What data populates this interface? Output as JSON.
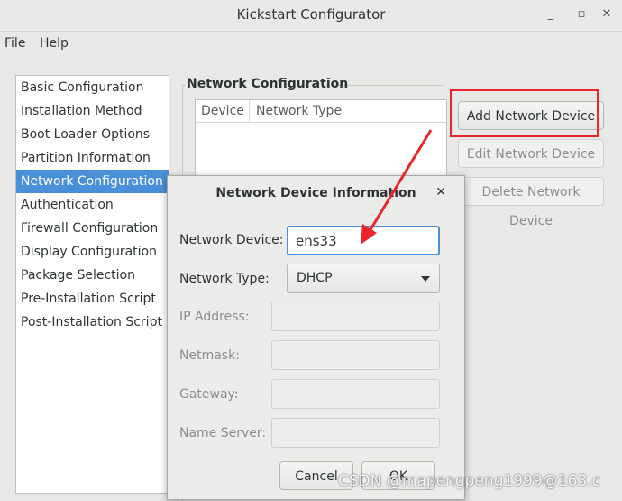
{
  "window": {
    "title": "Kickstart Configurator"
  },
  "menubar": {
    "file": "File",
    "help": "Help"
  },
  "sidebar": {
    "items": [
      {
        "label": "Basic Configuration"
      },
      {
        "label": "Installation Method"
      },
      {
        "label": "Boot Loader Options"
      },
      {
        "label": "Partition Information"
      },
      {
        "label": "Network Configuration",
        "selected": true
      },
      {
        "label": "Authentication"
      },
      {
        "label": "Firewall Configuration"
      },
      {
        "label": "Display Configuration"
      },
      {
        "label": "Package Selection"
      },
      {
        "label": "Pre-Installation Script"
      },
      {
        "label": "Post-Installation Script"
      }
    ]
  },
  "network": {
    "group_label": "Network Configuration",
    "table": {
      "columns": [
        "Device",
        "Network Type"
      ],
      "rows": []
    },
    "add_button": "Add Network Device",
    "edit_button": "Edit Network Device",
    "delete_button": "Delete Network Device"
  },
  "dialog": {
    "title": "Network Device Information",
    "device_label": "Network Device:",
    "device_value": "ens33",
    "type_label": "Network Type:",
    "type_value": "DHCP",
    "ip_label": "IP Address:",
    "netmask_label": "Netmask:",
    "gateway_label": "Gateway:",
    "nameserver_label": "Name Server:",
    "cancel_button": "Cancel",
    "ok_button": "OK"
  },
  "watermark": "CSDN @mapengpeng1999@163.c",
  "colors": {
    "selection": "#4a90d9",
    "annotation": "#e8262c"
  }
}
